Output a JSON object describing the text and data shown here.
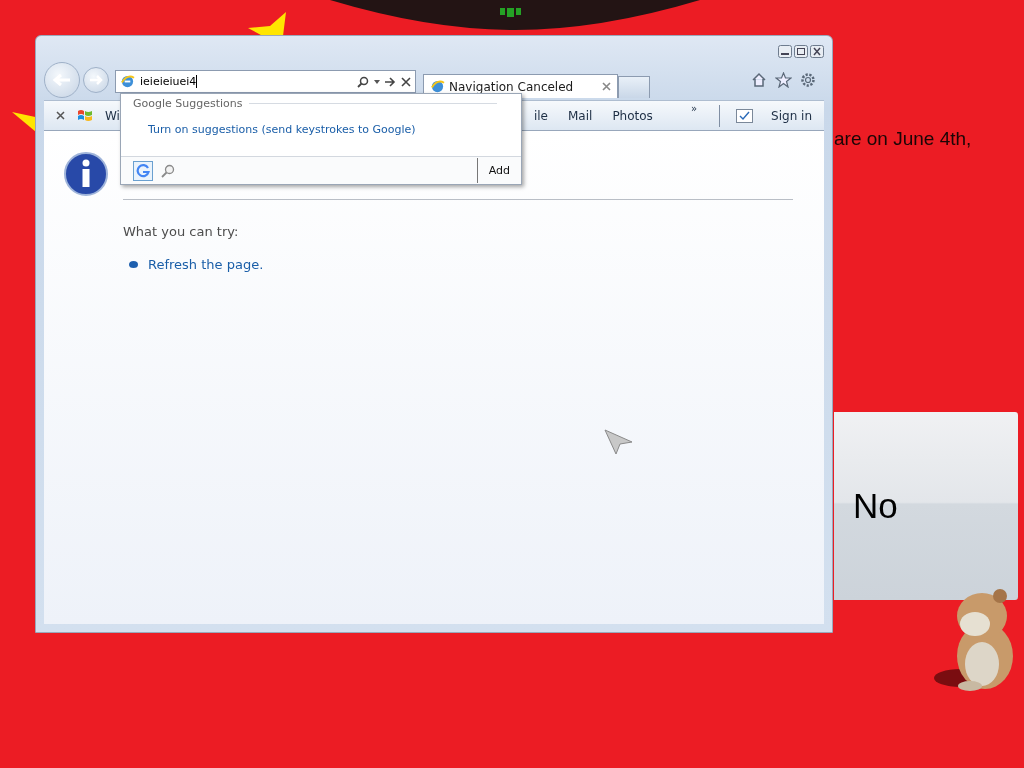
{
  "background_text": "are on June 4th,",
  "browser": {
    "address_bar": {
      "value": "ieieieiuei4"
    },
    "tabs": [
      {
        "label": "Navigation Canceled",
        "selected": true
      }
    ],
    "favorites_bar": {
      "items": [
        "Wi",
        "ile",
        "Mail",
        "Photos"
      ],
      "overflow": "»",
      "sign_in": "Sign in"
    },
    "suggestions_popup": {
      "heading": "Google Suggestions",
      "items": [
        "Turn on suggestions (send keystrokes to Google)"
      ],
      "add_button": "Add"
    },
    "page": {
      "subheading": "What you can try:",
      "links": [
        "Refresh the page."
      ]
    }
  },
  "no_button": "No"
}
